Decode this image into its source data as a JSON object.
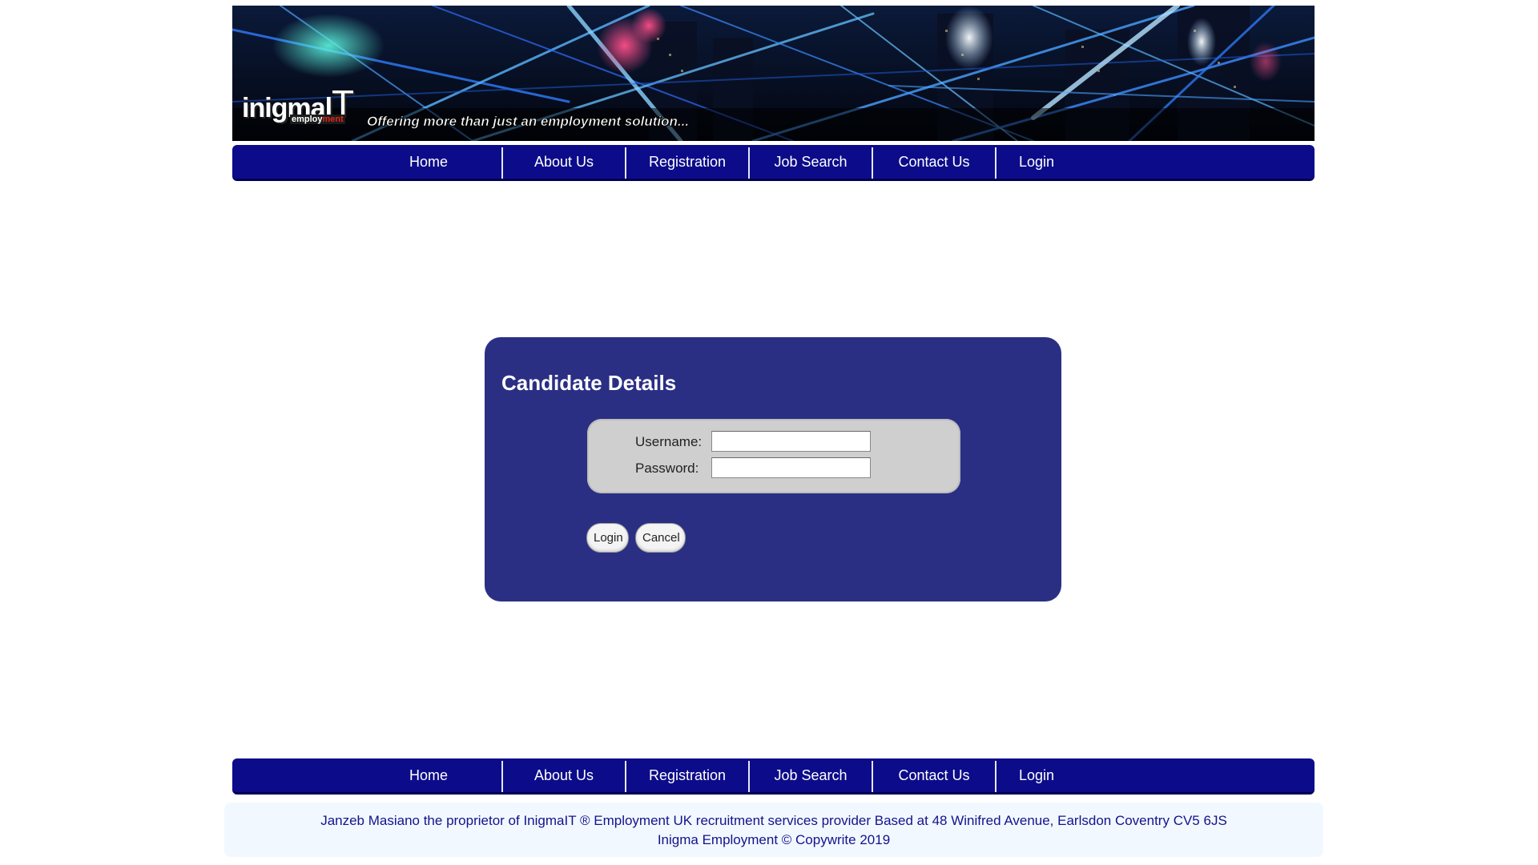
{
  "banner": {
    "logo_word": "inigmal",
    "logo_t": "T",
    "logo_sub_a": "employ",
    "logo_sub_b": "ment",
    "tagline": "Offering more than just an employment solution..."
  },
  "nav": {
    "items": [
      {
        "label": "Home"
      },
      {
        "label": "About Us"
      },
      {
        "label": "Registration"
      },
      {
        "label": "Job Search"
      },
      {
        "label": "Contact Us"
      },
      {
        "label": "Login"
      }
    ]
  },
  "login_panel": {
    "title": "Candidate Details",
    "username_label": "Username:",
    "username_value": "",
    "password_label": "Password:",
    "password_value": "",
    "login_button": "Login",
    "cancel_button": "Cancel"
  },
  "footer": {
    "line1": "Janzeb Masiano the proprietor of InigmaIT ® Employment UK recruitment services provider Based at 48 Winifred Avenue, Earlsdon Coventry CV5 6JS",
    "line2": "Inigma Employment © Copywrite 2019"
  },
  "colors": {
    "nav_bg": "#0c0c8a",
    "panel_bg": "#2a2f84",
    "footer_text": "#13138c",
    "footer_bg": "#f2f8ff"
  }
}
